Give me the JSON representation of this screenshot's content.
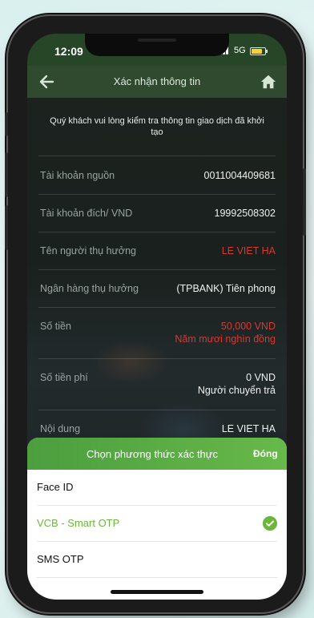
{
  "status_bar": {
    "time": "12:09",
    "network": "5G",
    "battery_level": 0.8
  },
  "header": {
    "title": "Xác nhận thông tin"
  },
  "notice": "Quý khách vui lòng kiểm tra thông tin giao dịch đã khởi tạo",
  "details": {
    "source_account": {
      "label": "Tài khoản nguồn",
      "value": "0011004409681"
    },
    "dest_account": {
      "label": "Tài khoản đích/ VND",
      "value": "19992508302"
    },
    "beneficiary_name": {
      "label": "Tên người thụ hưởng",
      "value": "LE VIET HA"
    },
    "beneficiary_bank": {
      "label": "Ngân hàng thụ hưởng",
      "value": "(TPBANK) Tiên phong"
    },
    "amount": {
      "label": "Số tiền",
      "value": "50,000 VND",
      "words": "Năm mươi nghìn đồng"
    },
    "fee": {
      "label": "Số tiền phí",
      "value": "0 VND",
      "payer": "Người chuyển trả"
    },
    "content": {
      "label": "Nội dung",
      "value": "LE VIET HA"
    }
  },
  "auth_sheet": {
    "title": "Chọn phương thức xác thực",
    "close_label": "Đóng",
    "options": [
      {
        "label": "Face ID"
      },
      {
        "label": "VCB - Smart OTP",
        "selected": true
      },
      {
        "label": "SMS OTP"
      }
    ]
  },
  "colors": {
    "accent_green": "#6ab73b",
    "alert_red": "#d23b34",
    "header_bg": "#2f4a2f"
  }
}
